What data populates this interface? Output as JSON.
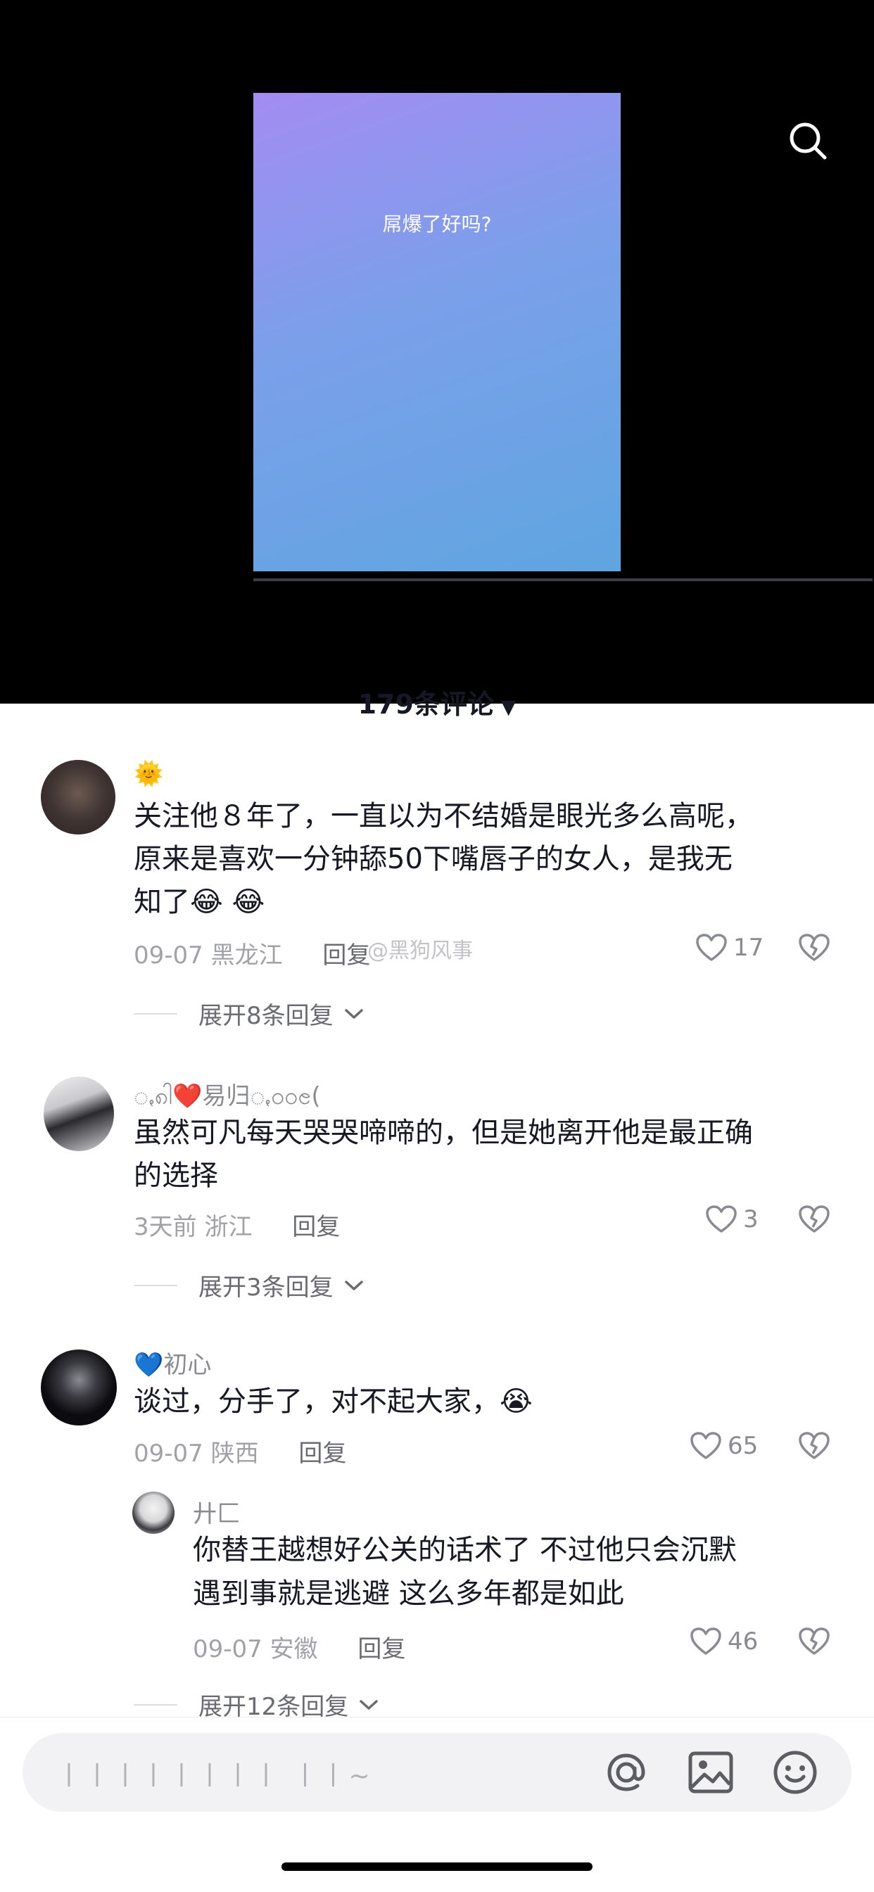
{
  "video": {
    "caption": "屌爆了好吗?"
  },
  "comments_header": {
    "count_label": "179条评论",
    "caret": "▼"
  },
  "comments": [
    {
      "username": "🌞",
      "text_lines": [
        "关注他８年了，一直以为不结婚是眼光多么高呢，",
        "原来是喜欢一分钟舔50下嘴唇子的女人，是我无",
        "知了😂 😂"
      ],
      "date": "09-07",
      "location": "黑龙江",
      "reply": "回复",
      "likes": "17",
      "expand": "展开8条回复"
    },
    {
      "username": "ꩻ၈ါ❤️易归ꩻ၀ဝၔ(",
      "text_lines": [
        "虽然可凡每天哭哭啼啼的，但是她离开他是最正确",
        "的选择"
      ],
      "date": "3天前",
      "location": "浙江",
      "reply": "回复",
      "likes": "3",
      "expand": "展开3条回复"
    },
    {
      "username": "💙初心",
      "text_lines": [
        "谈过，分手了，对不起大家，😭"
      ],
      "date": "09-07",
      "location": "陕西",
      "reply": "回复",
      "likes": "65"
    }
  ],
  "sub_reply": {
    "username": "廾匚",
    "text_lines": [
      "你替王越想好公关的话术了 不过他只会沉默",
      "遇到事就是逃避 这么多年都是如此"
    ],
    "date": "09-07",
    "location": "安徽",
    "reply": "回复",
    "likes": "46",
    "expand": "展开12条回复"
  },
  "watermark": "@黑狗风事",
  "input_bar": {
    "placeholder": "丨丨丨丨丨丨丨丨 丨丨~"
  },
  "icons": {
    "search": "search-icon",
    "heart": "heart-icon",
    "broken_heart": "dislike-icon",
    "chevron": "chevron-down-icon",
    "at": "at-icon",
    "image": "image-icon",
    "emoji": "emoji-icon"
  }
}
